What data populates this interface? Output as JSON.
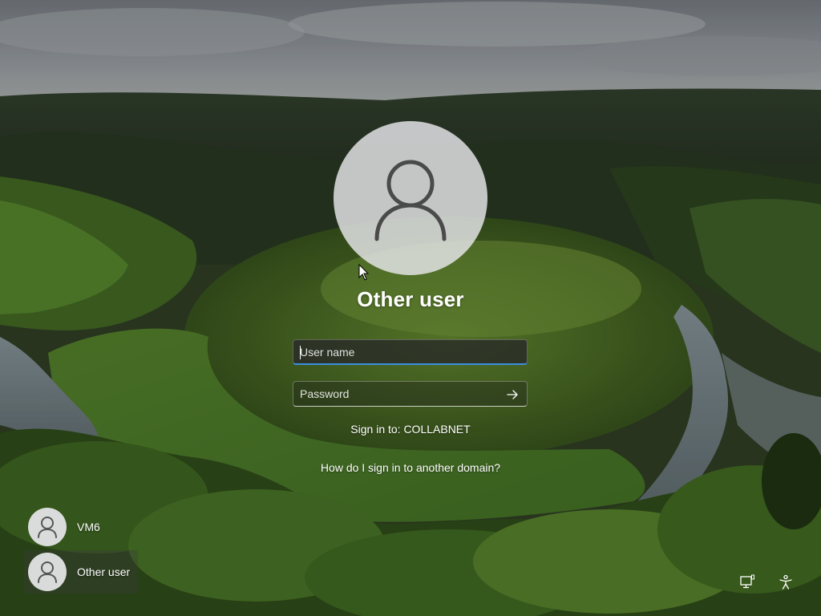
{
  "lock_screen": {
    "selected_user": "Other user"
  },
  "signin_form": {
    "username_placeholder": "User name",
    "password_placeholder": "Password",
    "submit_icon": "arrow-right-icon",
    "signin_domain_text": "Sign in to: COLLABNET",
    "other_domain_link": "How do I sign in to another domain?"
  },
  "user_switcher": {
    "users": [
      {
        "name": "VM6",
        "icon": "user-icon"
      },
      {
        "name": "Other user",
        "icon": "user-icon"
      }
    ]
  },
  "system_icons": {
    "network": "network-icon",
    "accessibility": "accessibility-icon"
  },
  "colors": {
    "focus_underline": "#3a8fe0",
    "text": "#ffffff",
    "avatar_background": "#e8e8ec"
  }
}
